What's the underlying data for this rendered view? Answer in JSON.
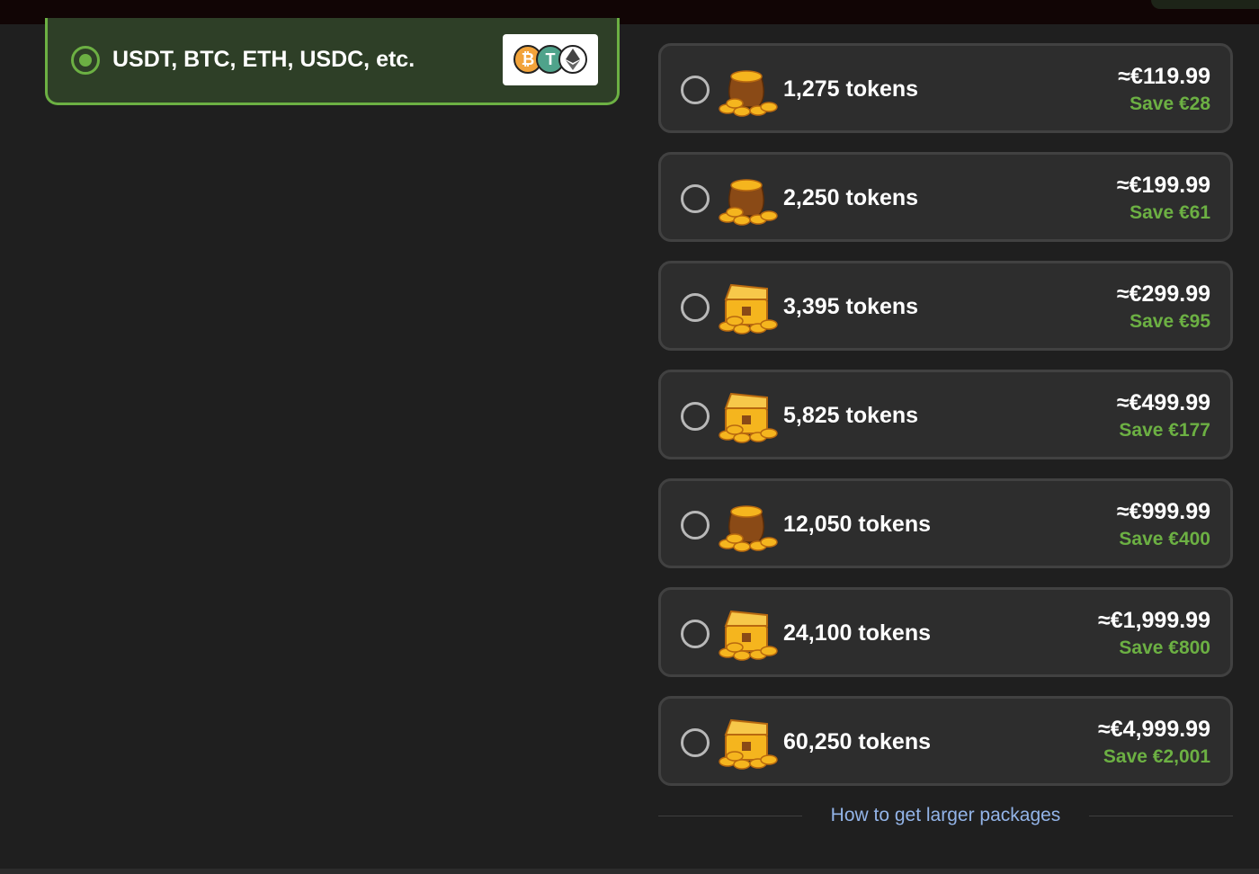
{
  "payment_method": {
    "label": "USDT, BTC, ETH, USDC, etc.",
    "selected": true,
    "coins": [
      "btc-coin-icon",
      "usdt-coin-icon",
      "eth-coin-icon"
    ],
    "accent_color": "#6cb043"
  },
  "packages": [
    {
      "tokens": "1,275 tokens",
      "price": "≈€119.99",
      "save": "Save €28",
      "icon": "coin-bag-small-icon"
    },
    {
      "tokens": "2,250 tokens",
      "price": "≈€199.99",
      "save": "Save €61",
      "icon": "coin-bag-large-icon"
    },
    {
      "tokens": "3,395 tokens",
      "price": "≈€299.99",
      "save": "Save €95",
      "icon": "treasure-chest-open-icon"
    },
    {
      "tokens": "5,825 tokens",
      "price": "≈€499.99",
      "save": "Save €177",
      "icon": "treasure-chest-coins-icon"
    },
    {
      "tokens": "12,050 tokens",
      "price": "≈€999.99",
      "save": "Save €400",
      "icon": "treasure-chest-bag-icon"
    },
    {
      "tokens": "24,100 tokens",
      "price": "≈€1,999.99",
      "save": "Save €800",
      "icon": "treasure-pile-icon"
    },
    {
      "tokens": "60,250 tokens",
      "price": "≈€4,999.99",
      "save": "Save €2,001",
      "icon": "treasure-hoard-icon"
    }
  ],
  "footer": {
    "link_text": "How to get larger packages",
    "link_color": "#93b4e8"
  },
  "colors": {
    "save_green": "#6cb043",
    "card_bg": "#2d2d2d",
    "page_bg": "#1f1f1f"
  }
}
